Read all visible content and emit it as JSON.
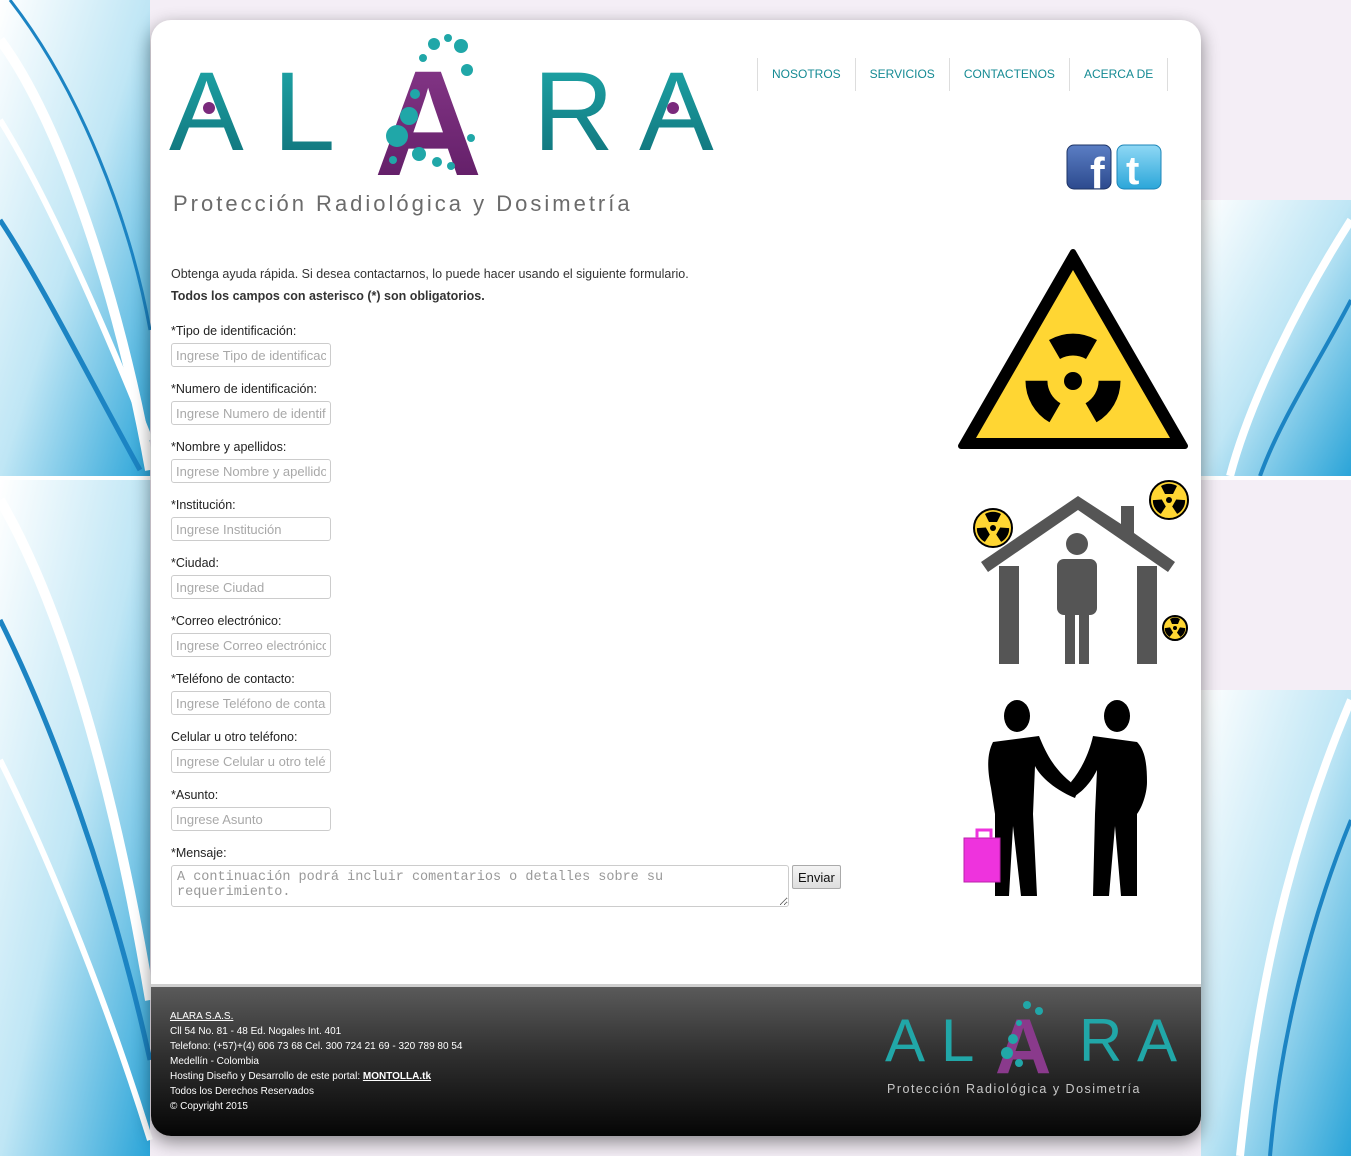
{
  "brand": {
    "logo_letters": [
      "A",
      "L",
      "A",
      "R",
      "A"
    ],
    "tagline": "Protección Radiológica y Dosimetría"
  },
  "nav": {
    "items": [
      "NOSOTROS",
      "SERVICIOS",
      "CONTACTENOS",
      "ACERCA DE"
    ]
  },
  "social": {
    "facebook_glyph": "f",
    "twitter_glyph": "t"
  },
  "intro": {
    "line1": "Obtenga ayuda rápida. Si desea contactarnos, lo puede hacer usando el siguiente formulario.",
    "line2": "Todos los campos con asterisco (*) son obligatorios."
  },
  "form": {
    "fields": [
      {
        "label": "*Tipo de identificación:",
        "placeholder": "Ingrese Tipo de identificación"
      },
      {
        "label": "*Numero de identificación:",
        "placeholder": "Ingrese Numero de identificación"
      },
      {
        "label": "*Nombre y apellidos:",
        "placeholder": "Ingrese Nombre y apellidos"
      },
      {
        "label": "*Institución:",
        "placeholder": "Ingrese Institución"
      },
      {
        "label": "*Ciudad:",
        "placeholder": "Ingrese Ciudad"
      },
      {
        "label": "*Correo electrónico:",
        "placeholder": "Ingrese Correo electrónico"
      },
      {
        "label": "*Teléfono de contacto:",
        "placeholder": "Ingrese Teléfono de contacto"
      },
      {
        "label": "Celular u otro teléfono:",
        "placeholder": "Ingrese Celular u otro teléfono"
      },
      {
        "label": "*Asunto:",
        "placeholder": "Ingrese Asunto"
      }
    ],
    "message_label": "*Mensaje:",
    "message_placeholder": "A continuación podrá incluir comentarios o detalles sobre su requerimiento.",
    "submit_label": "Enviar"
  },
  "footer": {
    "company": "ALARA S.A.S.",
    "address": "Cll 54 No. 81 - 48 Ed. Nogales Int. 401",
    "phone": "Telefono: (+57)+(4) 606 73 68 Cel. 300 724 21 69 - 320 789 80 54",
    "city": "Medellín - Colombia",
    "hosting_prefix": "Hosting Diseño y Desarrollo de este portal: ",
    "hosting_link": "MONTOLLA.tk",
    "rights": "Todos los Derechos Reservados",
    "copyright": "© Copyright 2015"
  },
  "colors": {
    "teal": "#148a93",
    "purple": "#7a2a7c",
    "hazard_yellow": "#ffd633",
    "briefcase": "#ee33dd",
    "house_gray": "#555555"
  },
  "icons": {
    "hazard": "radiation-warning-icon",
    "house": "house-radiation-icon",
    "handshake": "handshake-icon"
  }
}
